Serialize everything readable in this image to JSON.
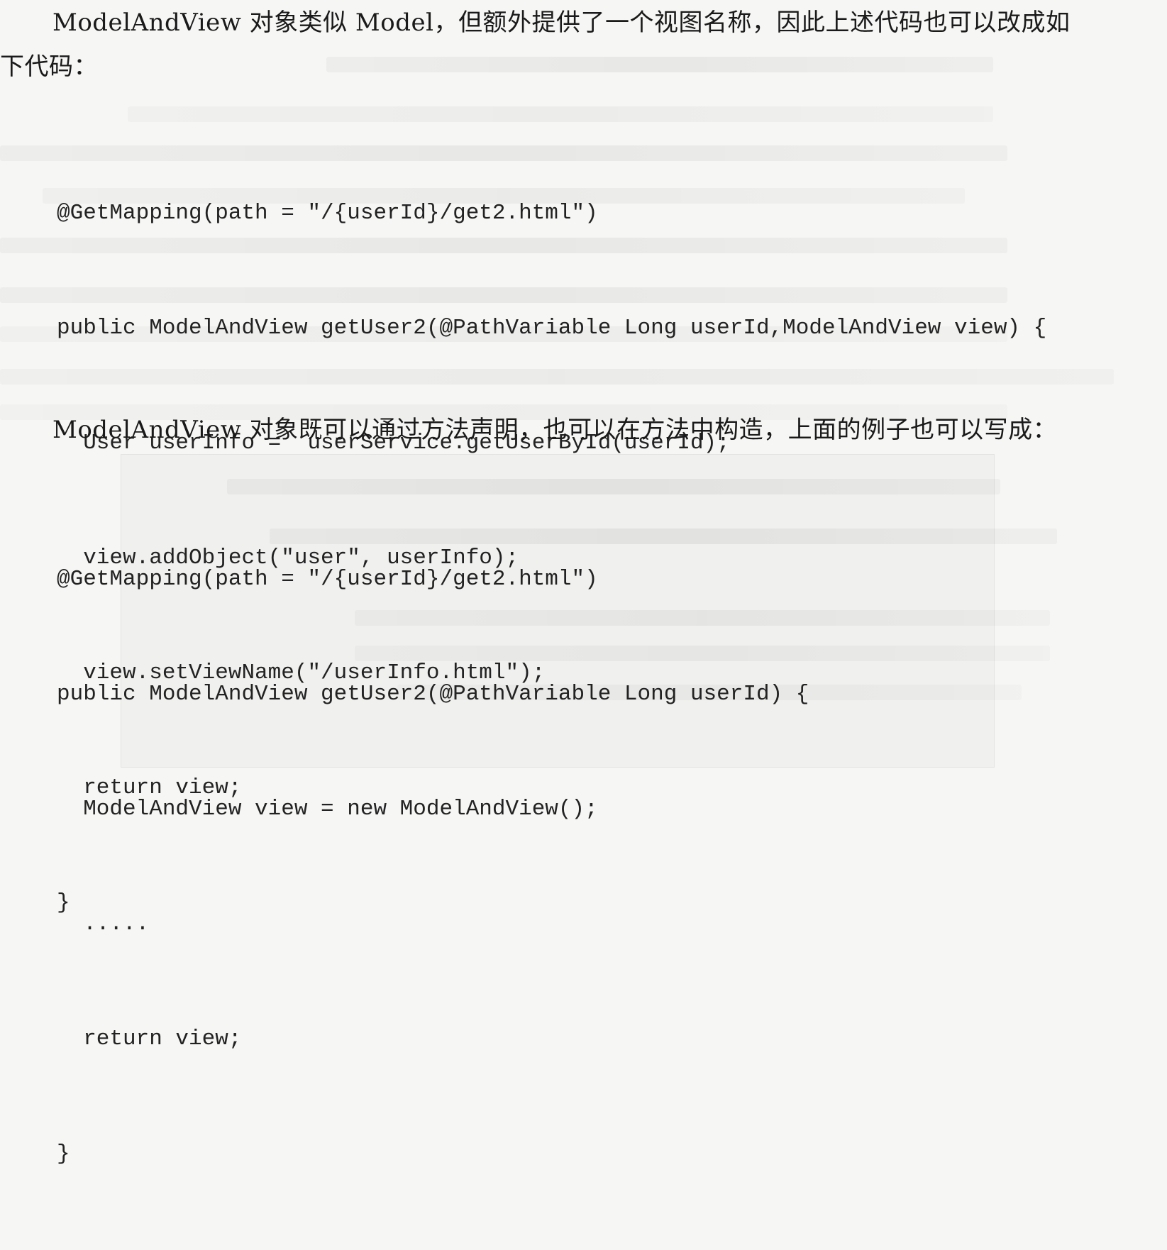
{
  "paragraph1": {
    "line1": "ModelAndView 对象类似 Model，但额外提供了一个视图名称，因此上述代码也可以改成如",
    "line2": "下代码："
  },
  "code1": [
    "@GetMapping(path = \"/{userId}/get2.html\")",
    "public ModelAndView getUser2(@PathVariable Long userId,ModelAndView view) {",
    "  User userInfo =  userService.getUserById(userId);",
    "  view.addObject(\"user\", userInfo);",
    "  view.setViewName(\"/userInfo.html\");",
    "  return view;",
    "}"
  ],
  "paragraph2": {
    "line1": "ModelAndView 对象既可以通过方法声明，也可以在方法中构造，上面的例子也可以写成："
  },
  "code2": [
    "@GetMapping(path = \"/{userId}/get2.html\")",
    "public ModelAndView getUser2(@PathVariable Long userId) {",
    "  ModelAndView view = new ModelAndView();",
    "  .....",
    "  return view;",
    "}"
  ]
}
